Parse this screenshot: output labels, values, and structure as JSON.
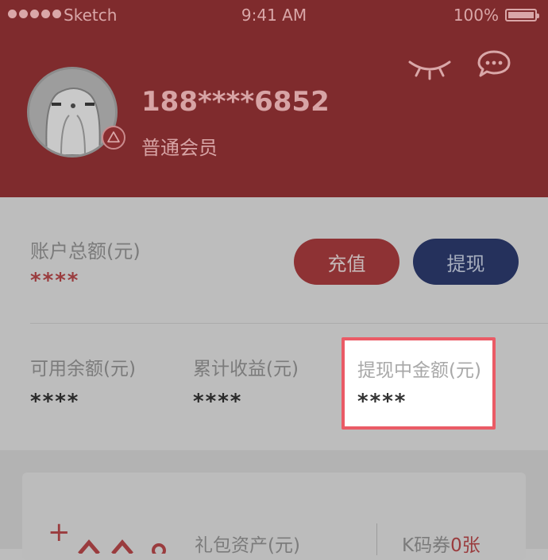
{
  "status_bar": {
    "carrier": "Sketch",
    "time": "9:41 AM",
    "battery": "100%"
  },
  "profile": {
    "phone": "188****6852",
    "member_level": "普通会员"
  },
  "account": {
    "total_label": "账户总额(元)",
    "total_value": "****",
    "recharge_label": "充值",
    "withdraw_label": "提现"
  },
  "stats": [
    {
      "label": "可用余额(元)",
      "value": "****"
    },
    {
      "label": "累计收益(元)",
      "value": "****"
    },
    {
      "label": "提现中金额(元)",
      "value": "****"
    }
  ],
  "assets": {
    "gift_label": "礼包资产(元)",
    "coupon_prefix": "K码券",
    "coupon_count": "0张"
  },
  "colors": {
    "header": "#7f2b2d",
    "accent_red": "#9a3c3e",
    "navy": "#25315c",
    "highlight_border": "#ea5b66"
  },
  "icons": [
    "eye-closed-icon",
    "chat-icon",
    "avatar",
    "level-badge-icon",
    "plus-icon",
    "gift-icon"
  ]
}
